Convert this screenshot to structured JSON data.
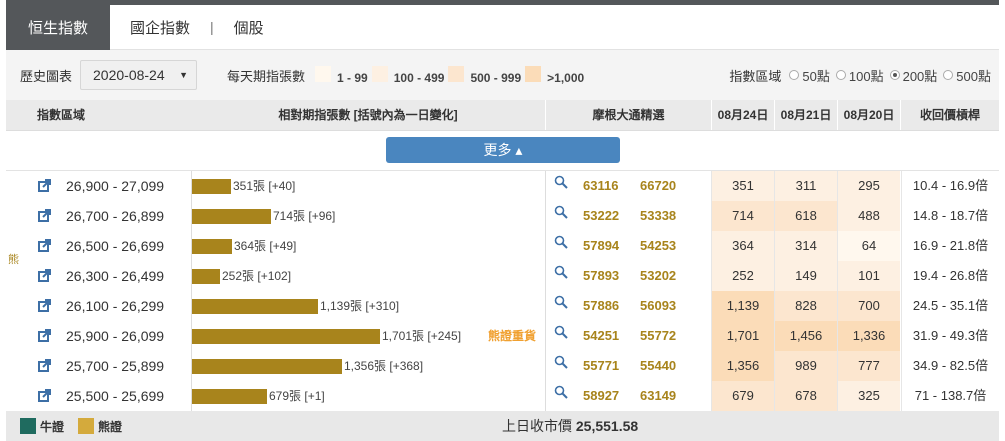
{
  "tabs": [
    {
      "label": "恒生指數",
      "active": true
    },
    {
      "label": "國企指數"
    },
    {
      "label": "個股"
    }
  ],
  "tab_separator": "|",
  "filter": {
    "history_label": "歷史圖表",
    "date_value": "2020-08-24",
    "daily_label": "每天期指張數",
    "legend": [
      {
        "label": "1 - 99",
        "color": "#fff8ee"
      },
      {
        "label": "100 - 499",
        "color": "#fdf0e2"
      },
      {
        "label": "500 - 999",
        "color": "#fce6cf"
      },
      {
        "label": ">1,000",
        "color": "#fbdcb8"
      }
    ],
    "zone_label": "指數區域",
    "zone_options": [
      {
        "label": "50點"
      },
      {
        "label": "100點"
      },
      {
        "label": "200點",
        "selected": true
      },
      {
        "label": "500點"
      }
    ]
  },
  "headers": {
    "zone": "指數區域",
    "contracts": "相對期指張數 [括號內為一日變化]",
    "picks": "摩根大通精選",
    "d1": "08月24日",
    "d2": "08月21日",
    "d3": "08月20日",
    "leverage": "收回價槓桿"
  },
  "more_label": "更多 ▴",
  "bear_label": "熊",
  "heavy_label": "熊證重貨",
  "bar_color": "#a8841c",
  "rows": [
    {
      "range": "26,900 - 27,099",
      "contracts": 351,
      "bar_text": "351張 [+40]",
      "codes": [
        "63116",
        "66720"
      ],
      "days": [
        "351",
        "311",
        "295"
      ],
      "leverage": "10.4 - 16.9倍"
    },
    {
      "range": "26,700 - 26,899",
      "contracts": 714,
      "bar_text": "714張 [+96]",
      "codes": [
        "53222",
        "53338"
      ],
      "days": [
        "714",
        "618",
        "488"
      ],
      "leverage": "14.8 - 18.7倍"
    },
    {
      "range": "26,500 - 26,699",
      "contracts": 364,
      "bar_text": "364張 [+49]",
      "codes": [
        "57894",
        "54253"
      ],
      "days": [
        "364",
        "314",
        "64"
      ],
      "leverage": "16.9 - 21.8倍"
    },
    {
      "range": "26,300 - 26,499",
      "contracts": 252,
      "bar_text": "252張 [+102]",
      "codes": [
        "57893",
        "53202"
      ],
      "days": [
        "252",
        "149",
        "101"
      ],
      "leverage": "19.4 - 26.8倍"
    },
    {
      "range": "26,100 - 26,299",
      "contracts": 1139,
      "bar_text": "1,139張 [+310]",
      "codes": [
        "57886",
        "56093"
      ],
      "days": [
        "1,139",
        "828",
        "700"
      ],
      "leverage": "24.5 - 35.1倍"
    },
    {
      "range": "25,900 - 26,099",
      "contracts": 1701,
      "bar_text": "1,701張 [+245]",
      "heavy": true,
      "codes": [
        "54251",
        "55772"
      ],
      "days": [
        "1,701",
        "1,456",
        "1,336"
      ],
      "leverage": "31.9 - 49.3倍"
    },
    {
      "range": "25,700 - 25,899",
      "contracts": 1356,
      "bar_text": "1,356張 [+368]",
      "codes": [
        "55771",
        "55440"
      ],
      "days": [
        "1,356",
        "989",
        "777"
      ],
      "leverage": "34.9 - 82.5倍"
    },
    {
      "range": "25,500 - 25,699",
      "contracts": 679,
      "bar_text": "679張 [+1]",
      "codes": [
        "58927",
        "63149"
      ],
      "days": [
        "679",
        "678",
        "325"
      ],
      "leverage": "71 - 138.7倍"
    }
  ],
  "footer": {
    "bull_label": "牛證",
    "bull_color": "#1f6b5f",
    "bear_label": "熊證",
    "bear_color": "#d4aa3c",
    "close_label": "上日收市價",
    "close_value": "25,551.58"
  }
}
